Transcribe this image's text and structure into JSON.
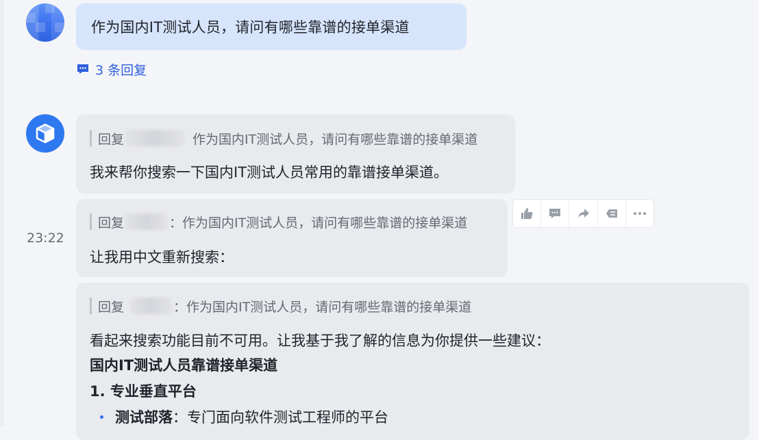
{
  "user_message": {
    "text": "作为国内IT测试人员，请问有哪些靠谱的接单渠道",
    "replies_label": "3 条回复"
  },
  "bot": {
    "timestamp": "23:22",
    "messages": [
      {
        "quote_prefix": "回复",
        "quote_suffix": "作为国内IT测试人员，请问有哪些靠谱的接单渠道",
        "text": "我来帮你搜索一下国内IT测试人员常用的靠谱接单渠道。"
      },
      {
        "quote_prefix": "回复",
        "quote_suffix": "：作为国内IT测试人员，请问有哪些靠谱的接单渠道",
        "text": "让我用中文重新搜索："
      },
      {
        "quote_prefix": "回复",
        "quote_suffix": "：作为国内IT测试人员，请问有哪些靠谱的接单渠道",
        "intro": "看起来搜索功能目前不可用。让我基于我了解的信息为你提供一些建议：",
        "heading": "国内IT测试人员靠谱接单渠道",
        "section": "1. 专业垂直平台",
        "bullet_title": "测试部落",
        "bullet_text": "：专门面向软件测试工程师的平台"
      }
    ]
  },
  "actions": {
    "icons": [
      "thumbs-up-icon",
      "comment-icon",
      "share-icon",
      "reply-icon",
      "more-icon"
    ]
  },
  "colors": {
    "user_bubble": "#d6e4fc",
    "bot_bubble": "#e9eaee",
    "link": "#2f5fdc",
    "bot_avatar": "#2e78f0"
  }
}
